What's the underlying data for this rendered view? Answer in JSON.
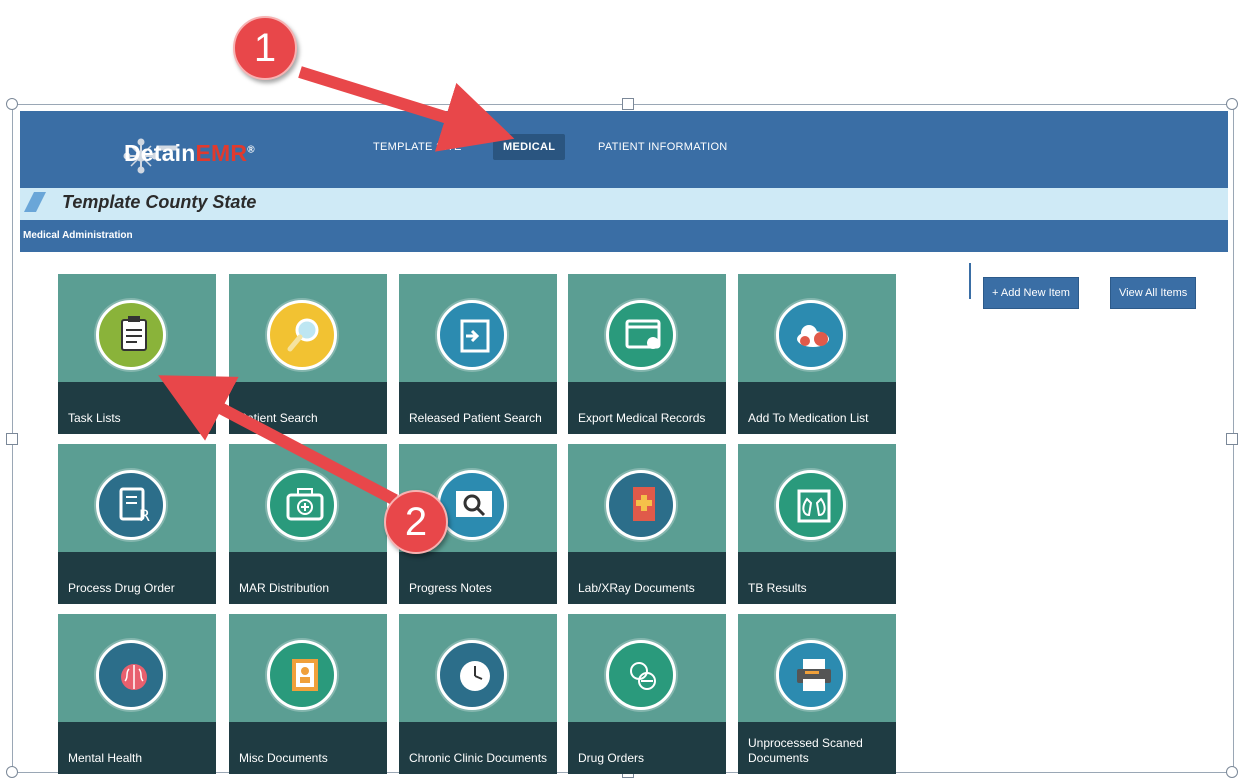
{
  "app": {
    "logo_main": "Detain",
    "logo_accent": "EMR",
    "logo_reg": "®"
  },
  "nav": {
    "items": [
      "TEMPLATE SITE",
      "MEDICAL",
      "PATIENT INFORMATION"
    ],
    "active": "MEDICAL"
  },
  "site": {
    "title": "Template County State"
  },
  "section": {
    "title": "Medical Administration"
  },
  "actions": {
    "add_new": "+ Add New Item",
    "view_all": "View All Items"
  },
  "tiles": [
    {
      "label": "Task Lists",
      "icon": "clipboard-icon",
      "color": "#8ab33a"
    },
    {
      "label": "Patient Search",
      "icon": "magnifier-icon",
      "color": "#f2c232"
    },
    {
      "label": "Released Patient Search",
      "icon": "exit-door-icon",
      "color": "#2c8bb0"
    },
    {
      "label": "Export Medical Records",
      "icon": "browser-settings-icon",
      "color": "#2a9a7c"
    },
    {
      "label": "Add To Medication List",
      "icon": "cloud-icon",
      "color": "#2c8bb0"
    },
    {
      "label": "Process Drug Order",
      "icon": "prescription-icon",
      "color": "#2c6e8a"
    },
    {
      "label": "MAR Distribution",
      "icon": "first-aid-kit-icon",
      "color": "#2a9a7c"
    },
    {
      "label": "Progress Notes",
      "icon": "search-document-icon",
      "color": "#2c8bb0"
    },
    {
      "label": "Lab/XRay Documents",
      "icon": "medical-book-icon",
      "color": "#2c6e8a"
    },
    {
      "label": "TB Results",
      "icon": "lungs-icon",
      "color": "#2a9a7c"
    },
    {
      "label": "Mental Health",
      "icon": "brain-icon",
      "color": "#2c6e8a"
    },
    {
      "label": "Misc Documents",
      "icon": "address-book-icon",
      "color": "#2a9a7c"
    },
    {
      "label": "Chronic Clinic Documents",
      "icon": "clock-icon",
      "color": "#2c6e8a"
    },
    {
      "label": "Drug Orders",
      "icon": "pills-icon",
      "color": "#2a9a7c"
    },
    {
      "label": "Unprocessed Scaned Documents",
      "icon": "printer-icon",
      "color": "#2c8bb0"
    }
  ],
  "callouts": [
    "1",
    "2"
  ]
}
